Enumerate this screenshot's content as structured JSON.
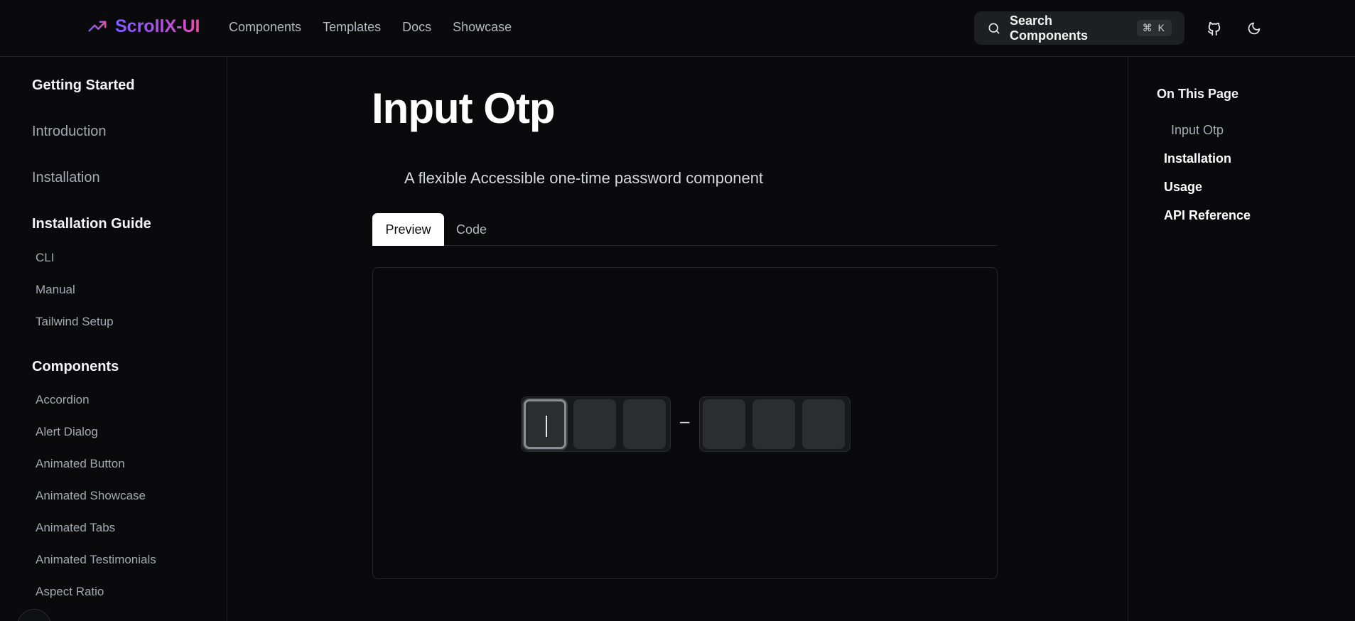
{
  "brand": {
    "name": "ScrollX-UI",
    "logo_icon": "trending-up-icon"
  },
  "nav": [
    {
      "label": "Components"
    },
    {
      "label": "Templates"
    },
    {
      "label": "Docs"
    },
    {
      "label": "Showcase"
    }
  ],
  "search": {
    "label": "Search Components",
    "shortcut_symbol": "⌘",
    "shortcut_key": "K"
  },
  "header_icons": {
    "github": "github-icon",
    "theme": "moon-icon"
  },
  "sidebar": {
    "getting_started": "Getting Started",
    "introduction": "Introduction",
    "installation": "Installation",
    "installation_guide": "Installation Guide",
    "guide_items": [
      "CLI",
      "Manual",
      "Tailwind Setup"
    ],
    "components": "Components",
    "component_items": [
      "Accordion",
      "Alert Dialog",
      "Animated Button",
      "Animated Showcase",
      "Animated Tabs",
      "Animated Testimonials",
      "Aspect Ratio"
    ]
  },
  "main": {
    "title": "Input Otp",
    "subtitle": "A flexible Accessible one-time password component",
    "tabs": {
      "preview": "Preview",
      "code": "Code"
    },
    "otp": {
      "separator": "–",
      "slots_per_group": 3,
      "groups": 2,
      "active_slot": 1
    }
  },
  "toc": {
    "title": "On This Page",
    "items": [
      "Input Otp",
      "Installation",
      "Usage",
      "API Reference"
    ]
  },
  "colors": {
    "background": "#0a0a0c",
    "brand_gradient_start": "#7c5cff",
    "brand_gradient_end": "#e84fa8",
    "tab_active_bg": "#ffffff"
  }
}
